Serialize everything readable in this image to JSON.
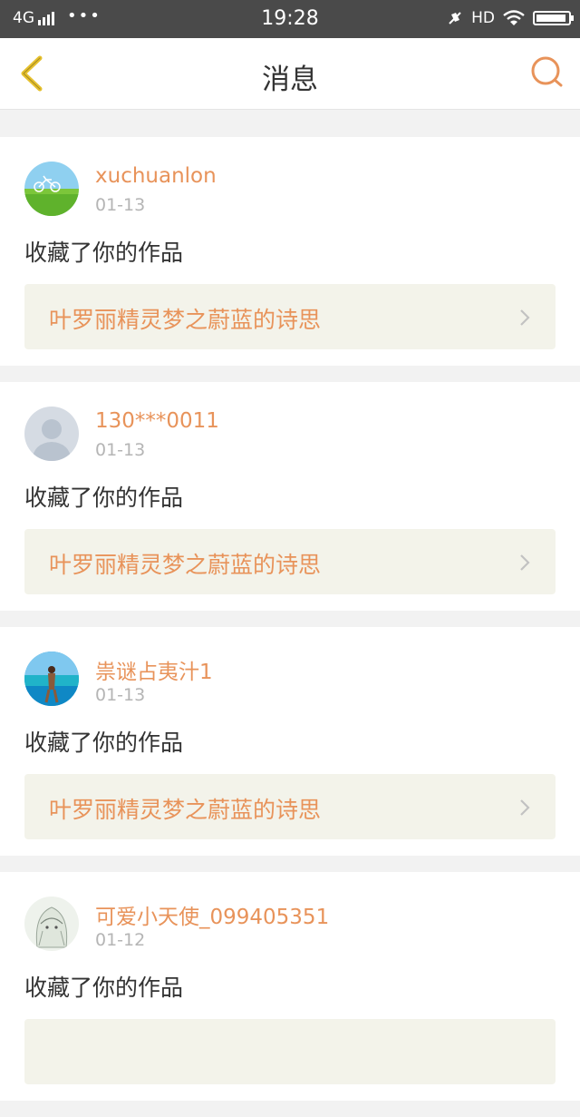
{
  "status_bar": {
    "network": "4G",
    "more": "•••",
    "time": "19:28",
    "hd": "HD",
    "icons": [
      "signal-icon",
      "vibrate-off-icon",
      "wifi-icon",
      "battery-icon"
    ]
  },
  "header": {
    "title": "消息",
    "back_icon": "chevron-left-icon",
    "search_icon": "search-icon"
  },
  "colors": {
    "accent": "#e8935a",
    "back_arrow": "#e6c12e",
    "status_bar": "#4a4a4a",
    "work_bg": "#f3f3ea"
  },
  "messages": [
    {
      "user": "xuchuanlon",
      "date": "01-13",
      "action": "收藏了你的作品",
      "work_title": "叶罗丽精灵梦之蔚蓝的诗思",
      "avatar": "bicycle-grass-photo"
    },
    {
      "user": "130***0011",
      "date": "01-13",
      "action": "收藏了你的作品",
      "work_title": "叶罗丽精灵梦之蔚蓝的诗思",
      "avatar": "default-user-icon"
    },
    {
      "user": "祟谜占夷汁1",
      "date": "01-13",
      "action": "收藏了你的作品",
      "work_title": "叶罗丽精灵梦之蔚蓝的诗思",
      "avatar": "beach-photo"
    },
    {
      "user": "可爱小天使_099405351",
      "date": "01-12",
      "action": "收藏了你的作品",
      "work_title": "",
      "avatar": "anime-girl-photo"
    }
  ]
}
